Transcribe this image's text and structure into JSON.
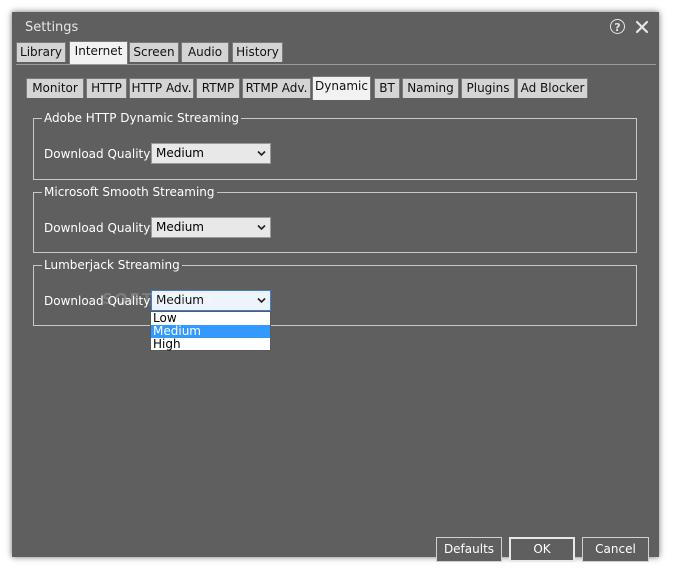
{
  "window": {
    "title": "Settings"
  },
  "top_tabs": [
    {
      "label": "Library",
      "active": false
    },
    {
      "label": "Internet",
      "active": true
    },
    {
      "label": "Screen",
      "active": false
    },
    {
      "label": "Audio",
      "active": false
    },
    {
      "label": "History",
      "active": false
    }
  ],
  "sub_tabs": [
    {
      "label": "Monitor",
      "active": false
    },
    {
      "label": "HTTP",
      "active": false
    },
    {
      "label": "HTTP Adv.",
      "active": false
    },
    {
      "label": "RTMP",
      "active": false
    },
    {
      "label": "RTMP Adv.",
      "active": false
    },
    {
      "label": "Dynamic",
      "active": true
    },
    {
      "label": "BT",
      "active": false
    },
    {
      "label": "Naming",
      "active": false
    },
    {
      "label": "Plugins",
      "active": false
    },
    {
      "label": "Ad Blocker",
      "active": false
    }
  ],
  "groups": [
    {
      "title": "Adobe HTTP Dynamic Streaming",
      "field_label": "Download Quality:",
      "value": "Medium"
    },
    {
      "title": "Microsoft Smooth Streaming",
      "field_label": "Download Quality:",
      "value": "Medium"
    },
    {
      "title": "Lumberjack Streaming",
      "field_label": "Download Quality:",
      "value": "Medium"
    }
  ],
  "dropdown": {
    "options": [
      "Low",
      "Medium",
      "High"
    ],
    "selected": "Medium"
  },
  "buttons": {
    "defaults": "Defaults",
    "ok": "OK",
    "cancel": "Cancel"
  },
  "watermark": "SOFTPEDIA"
}
